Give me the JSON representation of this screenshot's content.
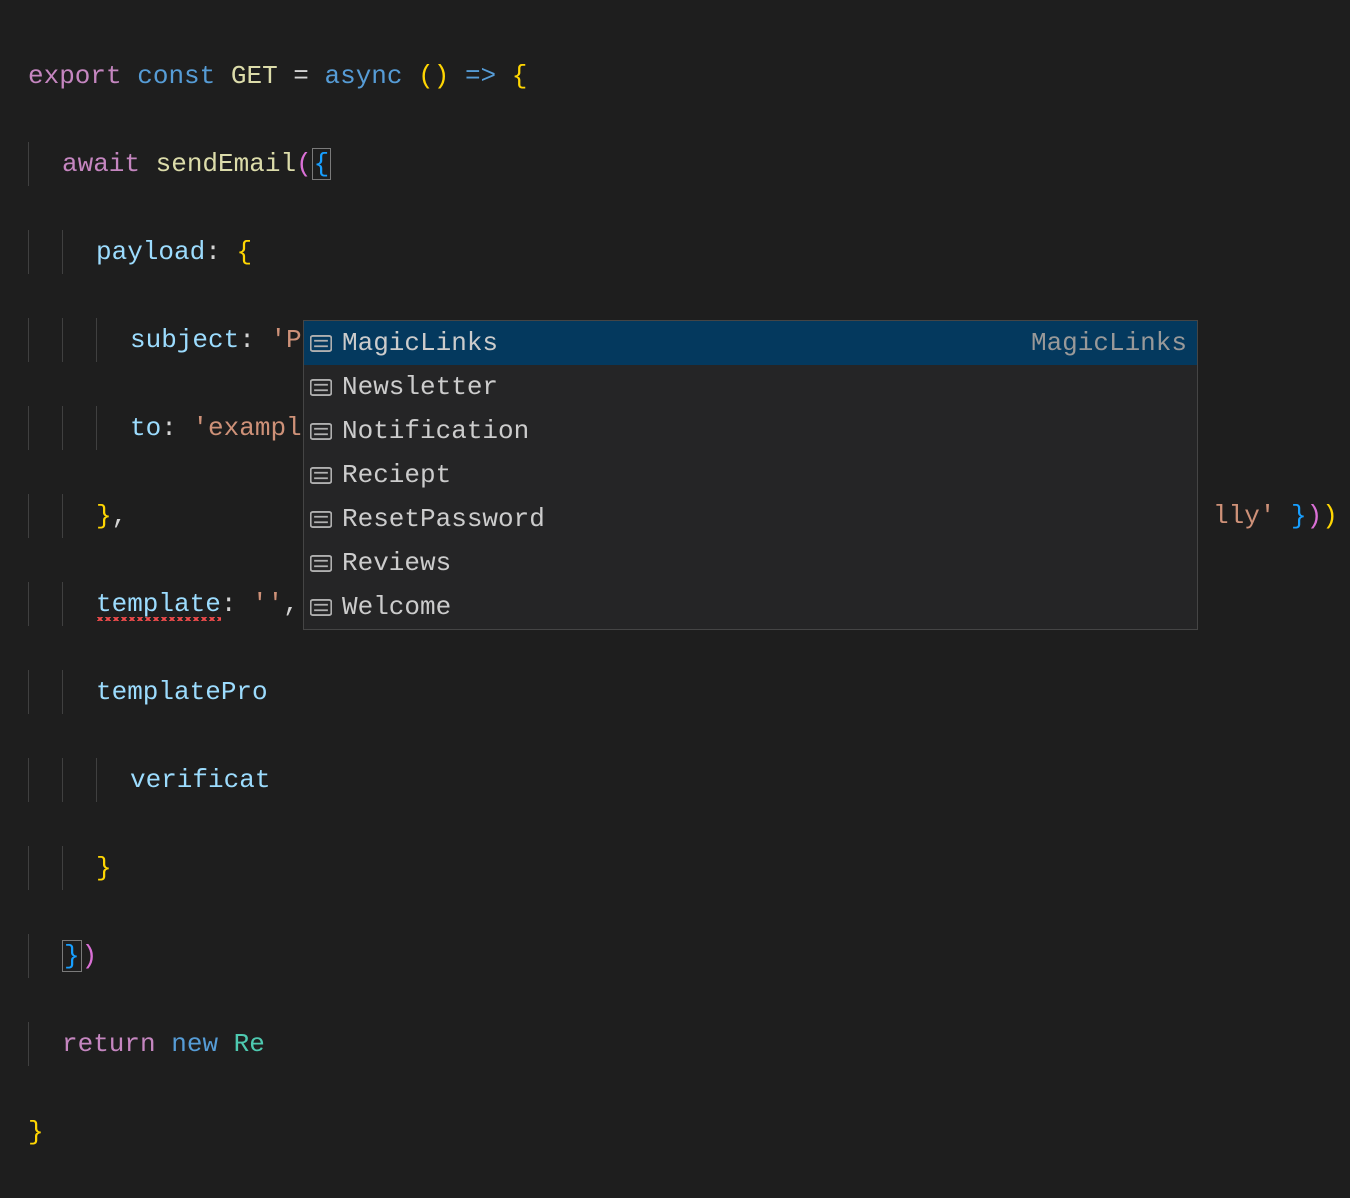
{
  "code": {
    "l1": {
      "export": "export",
      "const": "const",
      "get": "GET",
      "eq": "=",
      "async": "async",
      "paren": "()",
      "arrow": "=>",
      "brace": "{"
    },
    "l2": {
      "await": "await",
      "send": "sendEmail",
      "open": "(",
      "brace": "{"
    },
    "l3": {
      "payload": "payload",
      "colon": ":",
      "brace": "{"
    },
    "l4": {
      "subject": "subject",
      "colon": ":",
      "value": "'Please reply to me now'",
      "comma": ","
    },
    "l5": {
      "to": "to",
      "colon": ":",
      "value": "'example@gmail.com'",
      "comma": ","
    },
    "l6": {
      "close": "}",
      "comma": ","
    },
    "l7": {
      "template": "template",
      "colon": ":",
      "value": "''",
      "comma": ","
    },
    "l8": {
      "templatePro": "templatePro"
    },
    "l9": {
      "verificat": "verificat"
    },
    "l10": {
      "close": "}"
    },
    "l11": {
      "close": "}",
      "paren": ")"
    },
    "l12": {
      "return": "return",
      "new": "new",
      "re": "Re"
    },
    "l13": {
      "close": "}"
    },
    "tail": {
      "lly": "lly'",
      "space": " ",
      "b1": "}",
      "p": ")",
      "b2": ")"
    }
  },
  "popup": {
    "selected_detail": "MagicLinks",
    "items": [
      {
        "label": "MagicLinks",
        "selected": true
      },
      {
        "label": "Newsletter",
        "selected": false
      },
      {
        "label": "Notification",
        "selected": false
      },
      {
        "label": "Reciept",
        "selected": false
      },
      {
        "label": "ResetPassword",
        "selected": false
      },
      {
        "label": "Reviews",
        "selected": false
      },
      {
        "label": "Welcome",
        "selected": false
      }
    ]
  }
}
